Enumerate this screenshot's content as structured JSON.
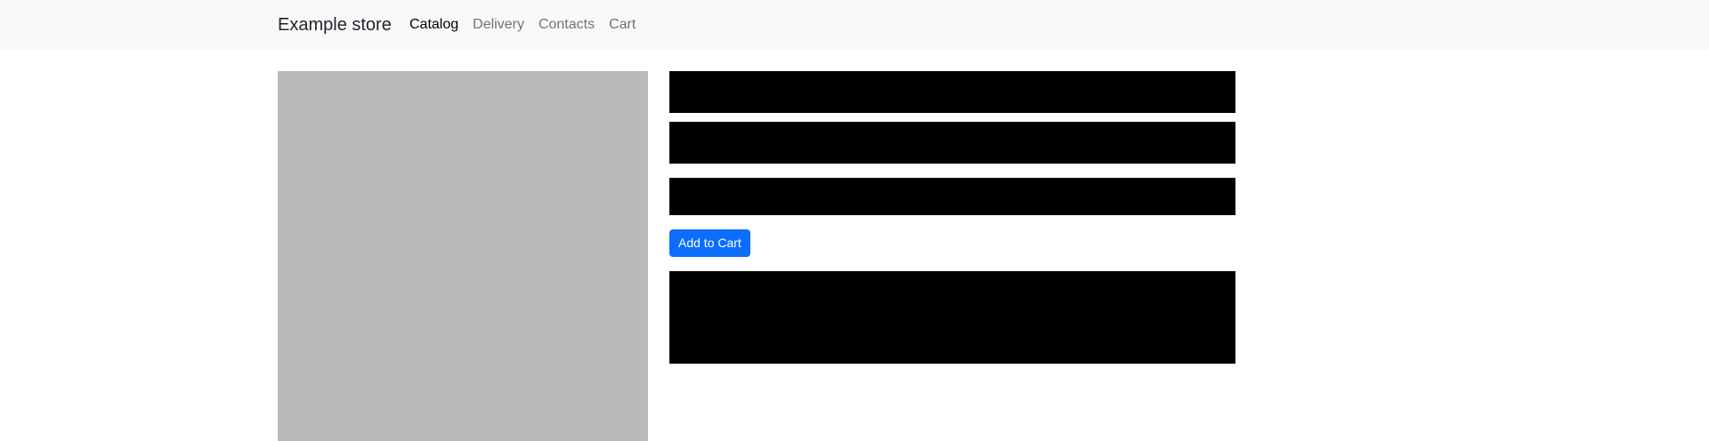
{
  "navbar": {
    "brand": "Example store",
    "links": [
      {
        "label": "Catalog",
        "active": true
      },
      {
        "label": "Delivery",
        "active": false
      },
      {
        "label": "Contacts",
        "active": false
      },
      {
        "label": "Cart",
        "active": false
      }
    ]
  },
  "product": {
    "add_to_cart_label": "Add to Cart"
  },
  "colors": {
    "navbar_bg": "#f8f9fa",
    "image_placeholder": "#bababa",
    "redaction": "#000000",
    "primary_button": "#0d6efd"
  }
}
